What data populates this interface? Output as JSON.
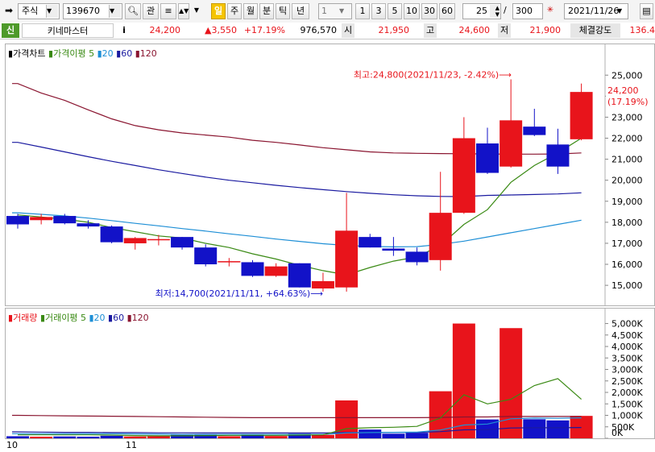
{
  "toolbar": {
    "market": "주식",
    "code": "139670",
    "btn_gwan": "관",
    "period_buttons": [
      "일",
      "주",
      "월",
      "분",
      "틱",
      "년"
    ],
    "interval_value": "1",
    "interval_buttons": [
      "1",
      "3",
      "5",
      "10",
      "30",
      "60"
    ],
    "count_value": "25",
    "slash": "/",
    "total_value": "300",
    "date": "2021/11/26"
  },
  "quote": {
    "badge": "신",
    "name": "키네마스터",
    "info": "i",
    "price": "24,200",
    "change": "▲3,550",
    "rate": "+17.19%",
    "volume": "976,570",
    "open_label": "시",
    "open": "21,950",
    "high_label": "고",
    "high": "24,600",
    "low_label": "저",
    "low": "21,900",
    "strength_label": "체결강도",
    "strength": "136.4"
  },
  "price_legend": {
    "title": "가격차트",
    "ma_label": "가격이평",
    "ma": [
      "5",
      "20",
      "60",
      "120"
    ]
  },
  "volume_legend": {
    "title": "거래량",
    "ma_label": "거래이평",
    "ma": [
      "5",
      "20",
      "60",
      "120"
    ]
  },
  "annotations": {
    "high": "최고:24,800(2021/11/23, -2.42%)⟶",
    "low": "최저:14,700(2021/11/11, +64.63%)⟶",
    "last_price": "24,200",
    "last_rate": "(17.19%)"
  },
  "x_labels": [
    "10",
    "11"
  ],
  "colors": {
    "up": "#e8141b",
    "down": "#1212c8",
    "ma5": "#3a8a14",
    "ma20": "#1e8fd6",
    "ma60": "#1a1aa0",
    "ma120": "#8a1530"
  },
  "chart_data": [
    {
      "type": "candlestick",
      "title": "가격차트",
      "ylim": [
        14200,
        25700
      ],
      "yticks": [
        15000,
        16000,
        17000,
        18000,
        19000,
        20000,
        21000,
        22000,
        23000,
        24000,
        25000
      ],
      "candles": [
        {
          "o": 18300,
          "h": 18400,
          "l": 17700,
          "c": 17900
        },
        {
          "o": 18100,
          "h": 18400,
          "l": 17900,
          "c": 18250
        },
        {
          "o": 18300,
          "h": 18400,
          "l": 17900,
          "c": 17950
        },
        {
          "o": 17950,
          "h": 18100,
          "l": 17700,
          "c": 17800
        },
        {
          "o": 17800,
          "h": 17850,
          "l": 17000,
          "c": 17050
        },
        {
          "o": 17000,
          "h": 17300,
          "l": 16700,
          "c": 17250
        },
        {
          "o": 17200,
          "h": 17400,
          "l": 16900,
          "c": 17200
        },
        {
          "o": 17300,
          "h": 17300,
          "l": 16700,
          "c": 16800
        },
        {
          "o": 16800,
          "h": 16950,
          "l": 15900,
          "c": 16000
        },
        {
          "o": 16150,
          "h": 16300,
          "l": 15900,
          "c": 16150
        },
        {
          "o": 16100,
          "h": 16200,
          "l": 15400,
          "c": 15450
        },
        {
          "o": 15450,
          "h": 16050,
          "l": 15400,
          "c": 15900
        },
        {
          "o": 16050,
          "h": 16050,
          "l": 14900,
          "c": 14900
        },
        {
          "o": 14850,
          "h": 15600,
          "l": 14700,
          "c": 15200
        },
        {
          "o": 14900,
          "h": 19400,
          "l": 14700,
          "c": 17600
        },
        {
          "o": 17300,
          "h": 17450,
          "l": 16800,
          "c": 16800
        },
        {
          "o": 16750,
          "h": 17300,
          "l": 16400,
          "c": 16650
        },
        {
          "o": 16600,
          "h": 16800,
          "l": 15950,
          "c": 16100
        },
        {
          "o": 16200,
          "h": 20400,
          "l": 15700,
          "c": 18450
        },
        {
          "o": 18450,
          "h": 23000,
          "l": 18400,
          "c": 22000
        },
        {
          "o": 21750,
          "h": 22500,
          "l": 20300,
          "c": 20350
        },
        {
          "o": 20650,
          "h": 24800,
          "l": 20600,
          "c": 22850
        },
        {
          "o": 22550,
          "h": 23400,
          "l": 22100,
          "c": 22150
        },
        {
          "o": 21700,
          "h": 22450,
          "l": 20300,
          "c": 20650
        },
        {
          "o": 21950,
          "h": 24600,
          "l": 21900,
          "c": 24200
        }
      ],
      "ma5": [
        18350,
        18250,
        18150,
        18000,
        17750,
        17550,
        17350,
        17250,
        17000,
        16800,
        16500,
        16250,
        15950,
        15700,
        15500,
        15850,
        16150,
        16350,
        16900,
        17900,
        18600,
        19900,
        20700,
        21300,
        22000
      ],
      "ma20": [
        18450,
        18380,
        18300,
        18200,
        18080,
        17950,
        17830,
        17700,
        17580,
        17450,
        17330,
        17200,
        17090,
        16980,
        16900,
        16850,
        16830,
        16840,
        16950,
        17100,
        17300,
        17500,
        17700,
        17900,
        18100
      ],
      "ma60": [
        21800,
        21580,
        21350,
        21120,
        20900,
        20700,
        20500,
        20320,
        20150,
        20000,
        19880,
        19760,
        19650,
        19550,
        19460,
        19380,
        19310,
        19260,
        19230,
        19220,
        19280,
        19300,
        19320,
        19350,
        19400
      ],
      "ma120": [
        24600,
        24150,
        23800,
        23350,
        22920,
        22600,
        22400,
        22250,
        22150,
        22050,
        21900,
        21800,
        21680,
        21550,
        21450,
        21350,
        21300,
        21280,
        21270,
        21260,
        21250,
        21240,
        21240,
        21250,
        21300
      ]
    },
    {
      "type": "bar",
      "title": "거래량",
      "ylim": [
        0,
        5300000
      ],
      "ytick_labels": [
        "5,000K",
        "4,500K",
        "4,000K",
        "3,500K",
        "3,000K",
        "2,500K",
        "2,000K",
        "1,500K",
        "1,000K",
        "500K",
        "0K"
      ],
      "yticks": [
        5000000,
        4500000,
        4000000,
        3500000,
        3000000,
        2500000,
        2000000,
        1500000,
        1000000,
        500000,
        0
      ],
      "values": [
        90000,
        70000,
        80000,
        70000,
        110000,
        80000,
        90000,
        150000,
        160000,
        90000,
        170000,
        100000,
        200000,
        150000,
        1650000,
        380000,
        200000,
        240000,
        2050000,
        5000000,
        820000,
        4800000,
        830000,
        780000,
        976570
      ],
      "up": [
        false,
        true,
        false,
        false,
        false,
        true,
        true,
        false,
        false,
        true,
        false,
        true,
        false,
        true,
        true,
        false,
        false,
        false,
        true,
        true,
        false,
        true,
        false,
        false,
        true
      ],
      "ma5": [
        150000,
        150000,
        150000,
        150000,
        140000,
        120000,
        110000,
        110000,
        120000,
        130000,
        130000,
        130000,
        140000,
        150000,
        420000,
        460000,
        480000,
        520000,
        880000,
        1900000,
        1500000,
        1700000,
        2300000,
        2600000,
        1700000
      ],
      "ma20": [
        200000,
        200000,
        200000,
        200000,
        200000,
        190000,
        180000,
        170000,
        170000,
        170000,
        170000,
        170000,
        170000,
        170000,
        230000,
        250000,
        260000,
        270000,
        360000,
        580000,
        620000,
        850000,
        880000,
        870000,
        890000
      ],
      "ma60": [
        280000,
        270000,
        260000,
        260000,
        250000,
        250000,
        240000,
        240000,
        230000,
        230000,
        230000,
        230000,
        230000,
        230000,
        250000,
        250000,
        260000,
        260000,
        290000,
        370000,
        380000,
        450000,
        460000,
        460000,
        470000
      ],
      "ma120": [
        1000000,
        990000,
        980000,
        970000,
        960000,
        950000,
        940000,
        930000,
        920000,
        910000,
        900000,
        900000,
        900000,
        900000,
        900000,
        900000,
        900000,
        900000,
        910000,
        930000,
        930000,
        950000,
        950000,
        950000,
        950000
      ]
    }
  ]
}
